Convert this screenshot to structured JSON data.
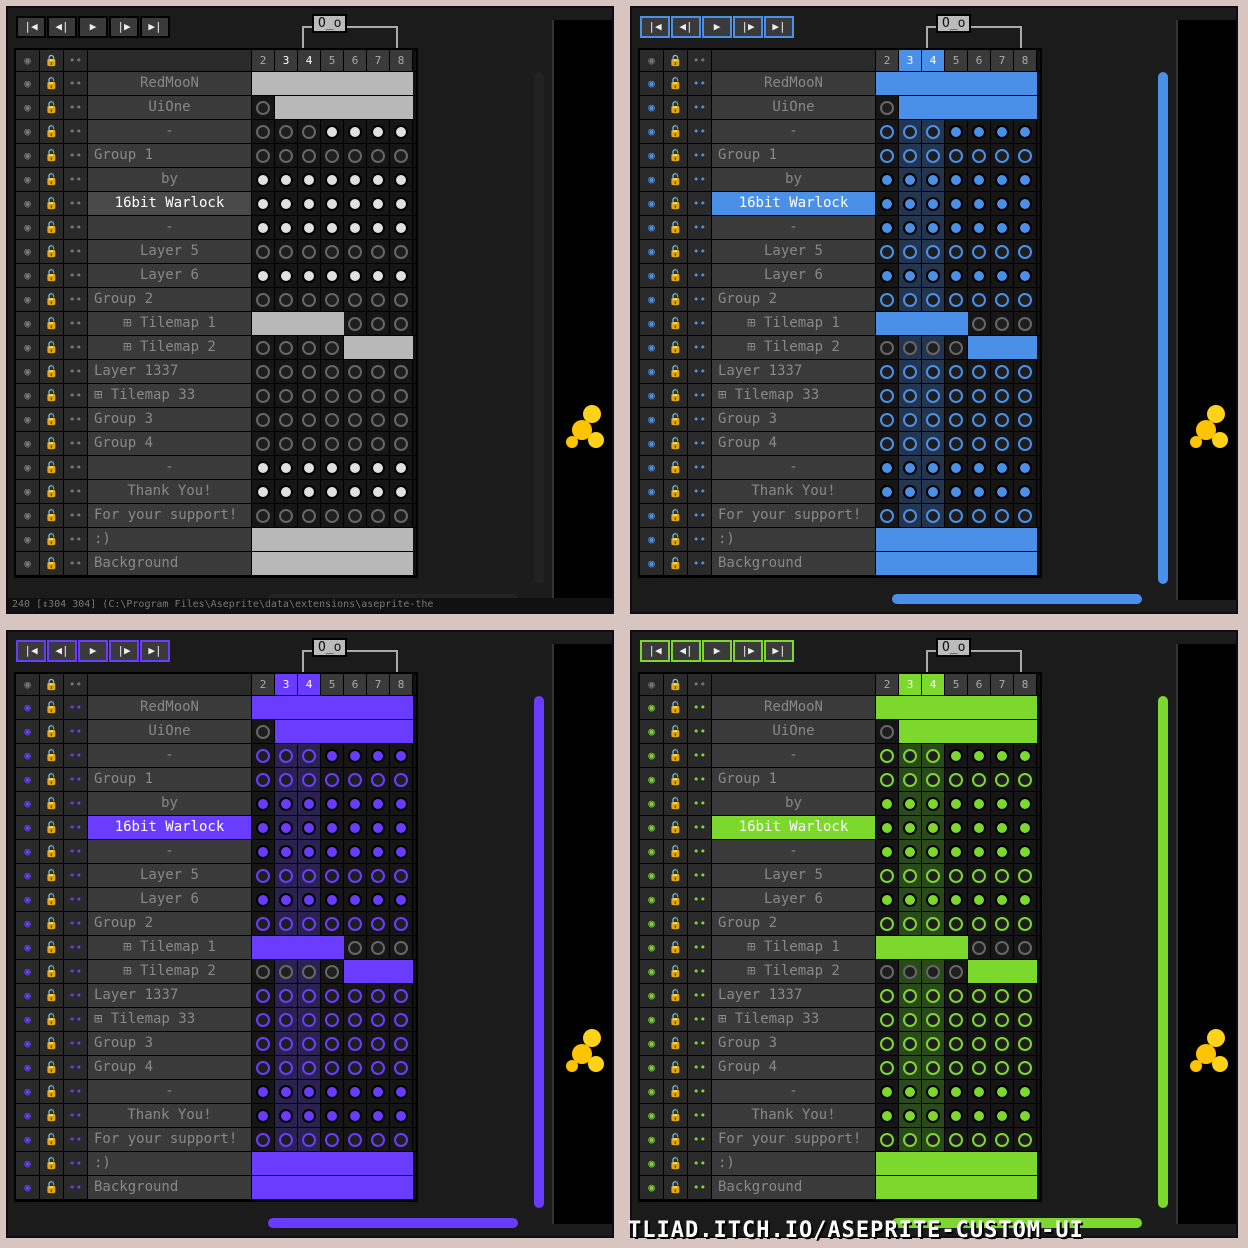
{
  "frames": [
    "2",
    "3",
    "4",
    "5",
    "6",
    "7",
    "8"
  ],
  "tag_label": "O_o",
  "footer": "TLIAD.ITCH.IO/ASEPRITE-CUSTOM-UI",
  "status_text": "240 [↕304 304] (C:\\Program Files\\Aseprite\\data\\extensions\\aseprite-the",
  "toolbar_icons": [
    "first-frame-icon",
    "prev-frame-icon",
    "play-icon",
    "next-frame-icon",
    "last-frame-icon"
  ],
  "layers": [
    {
      "name": "RedMooN",
      "align": "center",
      "cels": "bar"
    },
    {
      "name": "UiOne",
      "align": "center",
      "cels": "bar2"
    },
    {
      "name": "-",
      "align": "center",
      "cels": "mix1"
    },
    {
      "name": "Group 1",
      "align": "left",
      "cels": "empty"
    },
    {
      "name": "by",
      "align": "center",
      "cels": "full"
    },
    {
      "name": "16bit Warlock",
      "align": "center",
      "cels": "full",
      "selected": true
    },
    {
      "name": "-",
      "align": "center",
      "cels": "full"
    },
    {
      "name": "Layer 5",
      "align": "center",
      "cels": "empty"
    },
    {
      "name": "Layer 6",
      "align": "center",
      "cels": "full"
    },
    {
      "name": "Group 2",
      "align": "left",
      "cels": "empty"
    },
    {
      "name": "⊞ Tilemap 1",
      "align": "center",
      "cels": "bar3"
    },
    {
      "name": "⊞ Tilemap 2",
      "align": "center",
      "cels": "bar4"
    },
    {
      "name": "Layer 1337",
      "align": "left",
      "cels": "empty"
    },
    {
      "name": "⊞ Tilemap 33",
      "align": "left",
      "cels": "empty"
    },
    {
      "name": "Group 3",
      "align": "left",
      "cels": "empty"
    },
    {
      "name": "Group 4",
      "align": "left",
      "cels": "empty"
    },
    {
      "name": "-",
      "align": "center",
      "cels": "full"
    },
    {
      "name": "Thank You!",
      "align": "center",
      "cels": "full"
    },
    {
      "name": "For your support!",
      "align": "left",
      "cels": "empty"
    },
    {
      "name": ":)",
      "align": "left",
      "cels": "bar"
    },
    {
      "name": "Background",
      "align": "left",
      "cels": "bar"
    }
  ],
  "themes": [
    {
      "accent": "#cccccc",
      "bg": "#2f2f2f"
    },
    {
      "accent": "#4a90e8",
      "bg": "#24364f"
    },
    {
      "accent": "#6a3cff",
      "bg": "#2a2350"
    },
    {
      "accent": "#7dd82e",
      "bg": "#2b4a1c"
    }
  ]
}
